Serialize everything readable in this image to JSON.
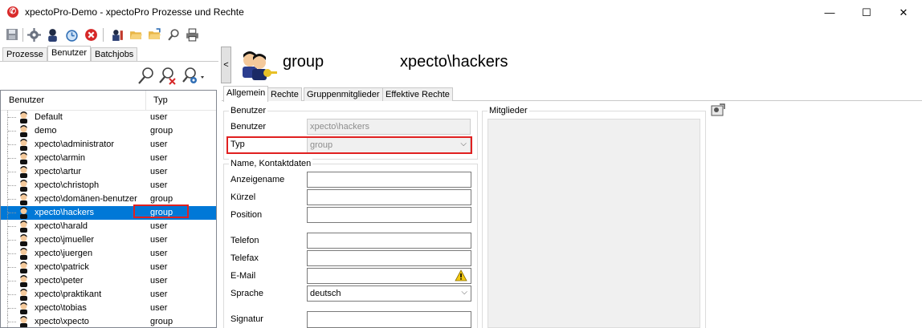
{
  "window": {
    "title": "xpectoPro-Demo - xpectoPro Prozesse und Rechte",
    "minimize": "—",
    "maximize": "☐",
    "close": "✕"
  },
  "toolbar": {
    "icons": [
      "save-icon",
      "settings-icon",
      "user-icon",
      "clock-icon",
      "stop-icon",
      "user-tools-icon",
      "folder-open-icon",
      "folder-icon",
      "search-icon",
      "print-icon"
    ]
  },
  "left": {
    "tabs": [
      "Prozesse",
      "Benutzer",
      "Batchjobs"
    ],
    "active_tab": "Benutzer",
    "columns": [
      "Benutzer",
      "Typ"
    ],
    "rows": [
      {
        "name": "Default",
        "typ": "user"
      },
      {
        "name": "demo",
        "typ": "group"
      },
      {
        "name": "xpecto\\administrator",
        "typ": "user"
      },
      {
        "name": "xpecto\\armin",
        "typ": "user"
      },
      {
        "name": "xpecto\\artur",
        "typ": "user"
      },
      {
        "name": "xpecto\\christoph",
        "typ": "user"
      },
      {
        "name": "xpecto\\domänen-benutzer",
        "typ": "group"
      },
      {
        "name": "xpecto\\hackers",
        "typ": "group"
      },
      {
        "name": "xpecto\\harald",
        "typ": "user"
      },
      {
        "name": "xpecto\\jmueller",
        "typ": "user"
      },
      {
        "name": "xpecto\\juergen",
        "typ": "user"
      },
      {
        "name": "xpecto\\patrick",
        "typ": "user"
      },
      {
        "name": "xpecto\\peter",
        "typ": "user"
      },
      {
        "name": "xpecto\\praktikant",
        "typ": "user"
      },
      {
        "name": "xpecto\\tobias",
        "typ": "user"
      },
      {
        "name": "xpecto\\xpecto",
        "typ": "group"
      }
    ],
    "selected_index": 7
  },
  "header": {
    "type": "group",
    "name": "xpecto\\hackers",
    "collapse": "<"
  },
  "right": {
    "tabs": [
      "Allgemein",
      "Rechte",
      "Gruppenmitglieder",
      "Effektive Rechte"
    ],
    "active_tab": "Allgemein",
    "benutzer_group": {
      "title": "Benutzer",
      "benutzer_label": "Benutzer",
      "benutzer_value": "xpecto\\hackers",
      "typ_label": "Typ",
      "typ_value": "group"
    },
    "kontakt_group": {
      "title": "Name, Kontaktdaten",
      "anzeigename": "Anzeigename",
      "kuerzel": "Kürzel",
      "position": "Position",
      "telefon": "Telefon",
      "telefax": "Telefax",
      "email": "E-Mail",
      "sprache": "Sprache",
      "sprache_value": "deutsch",
      "signatur": "Signatur"
    },
    "mitglieder_title": "Mitglieder"
  }
}
